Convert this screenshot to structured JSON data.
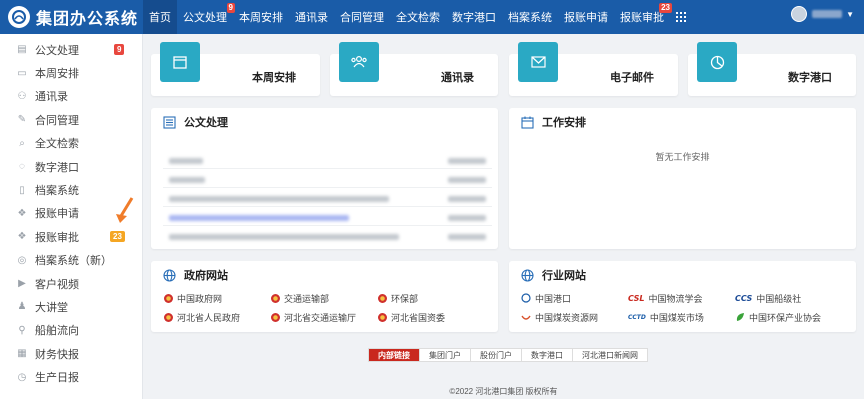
{
  "app": {
    "title": "集团办公系统"
  },
  "nav": {
    "items": [
      {
        "label": "首页",
        "active": true
      },
      {
        "label": "公文处理",
        "badge": "9"
      },
      {
        "label": "本周安排"
      },
      {
        "label": "通讯录"
      },
      {
        "label": "合同管理"
      },
      {
        "label": "全文检索"
      },
      {
        "label": "数字港口"
      },
      {
        "label": "档案系统"
      },
      {
        "label": "报账申请"
      },
      {
        "label": "报账审批",
        "badge": "23"
      }
    ]
  },
  "sidebar": {
    "items": [
      {
        "label": "公文处理",
        "icon": "list-icon",
        "badge": "9",
        "badge_color": "#e8473e"
      },
      {
        "label": "本周安排",
        "icon": "calendar-icon"
      },
      {
        "label": "通讯录",
        "icon": "contacts-icon"
      },
      {
        "label": "合同管理",
        "icon": "edit-icon"
      },
      {
        "label": "全文检索",
        "icon": "search-icon"
      },
      {
        "label": "数字港口",
        "icon": "chat-icon"
      },
      {
        "label": "档案系统",
        "icon": "file-icon"
      },
      {
        "label": "报账申请",
        "icon": "cubes-icon"
      },
      {
        "label": "报账审批",
        "icon": "cubes-icon",
        "badge": "23",
        "badge_color": "#f5a623"
      },
      {
        "label": "档案系统（新）",
        "icon": "target-icon"
      },
      {
        "label": "客户视频",
        "icon": "video-icon"
      },
      {
        "label": "大讲堂",
        "icon": "lecture-icon"
      },
      {
        "label": "船舶流向",
        "icon": "location-icon"
      },
      {
        "label": "财务快报",
        "icon": "calculator-icon"
      },
      {
        "label": "生产日报",
        "icon": "clock-icon"
      }
    ]
  },
  "quick_links": [
    {
      "label": "本周安排",
      "icon": "calendar-icon"
    },
    {
      "label": "通讯录",
      "icon": "contacts-icon"
    },
    {
      "label": "电子邮件",
      "icon": "mail-icon"
    },
    {
      "label": "数字港口",
      "icon": "pie-chart-icon"
    }
  ],
  "panels": {
    "documents": {
      "title": "公文处理",
      "row_count": 5
    },
    "schedule": {
      "title": "工作安排",
      "empty_text": "暂无工作安排"
    },
    "gov_sites": {
      "title": "政府网站",
      "links": [
        "中国政府网",
        "交通运输部",
        "环保部",
        "河北省人民政府",
        "河北省交通运输厅",
        "河北省国资委"
      ]
    },
    "industry_sites": {
      "title": "行业网站",
      "links": [
        {
          "label": "中国港口",
          "mark": ""
        },
        {
          "label": "中国物流学会",
          "mark": "CSL"
        },
        {
          "label": "中国船级社",
          "mark": "CCS"
        },
        {
          "label": "中国煤炭资源网",
          "mark": ""
        },
        {
          "label": "中国煤炭市场",
          "mark": "CCTD"
        },
        {
          "label": "中国环保产业协会",
          "mark": ""
        }
      ]
    }
  },
  "footer_tabs": [
    "内部链接",
    "集团门户",
    "股份门户",
    "数字港口",
    "河北港口新闻网"
  ],
  "footer_text": "©2022 河北港口集团 版权所有",
  "colors": {
    "primary": "#1a5ca8",
    "accent": "#2aa9c4",
    "badge_red": "#e8473e",
    "badge_orange": "#f5a623"
  }
}
